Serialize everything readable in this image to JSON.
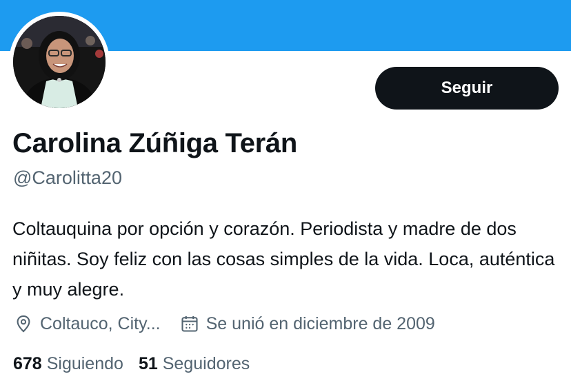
{
  "colors": {
    "banner": "#1d9bf0",
    "button_bg": "#0f1419",
    "secondary_text": "#536471"
  },
  "profile": {
    "display_name": "Carolina Zúñiga Terán",
    "handle": "@Carolitta20",
    "bio": "Coltauquina por opción y corazón. Periodista y madre de dos niñitas. Soy feliz con las cosas simples de la vida. Loca, auténtica y muy alegre.",
    "location": "Coltauco, City...",
    "joined": "Se unió en diciembre de 2009",
    "location_icon": "map-pin-icon",
    "joined_icon": "calendar-icon"
  },
  "actions": {
    "follow_label": "Seguir"
  },
  "stats": {
    "following_count": "678",
    "following_label": "Siguiendo",
    "followers_count": "51",
    "followers_label": "Seguidores"
  }
}
